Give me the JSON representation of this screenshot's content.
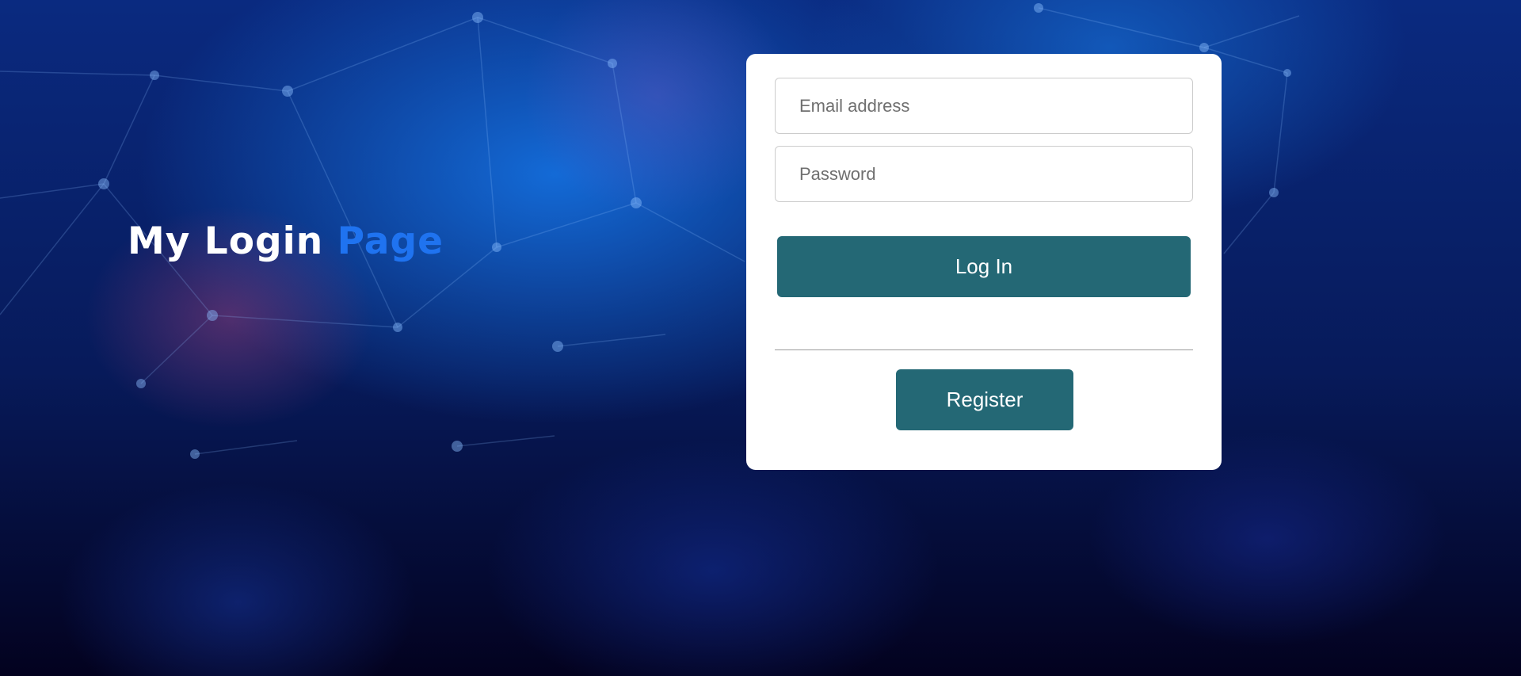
{
  "theme": {
    "accent_text": "#1f73f0",
    "button_bg": "#246875",
    "card_bg": "#ffffff"
  },
  "hero": {
    "title_main": "My Login",
    "title_accent": "Page"
  },
  "login_form": {
    "email_placeholder": "Email address",
    "email_value": "",
    "password_placeholder": "Password",
    "password_value": "",
    "login_label": "Log In",
    "register_label": "Register"
  }
}
